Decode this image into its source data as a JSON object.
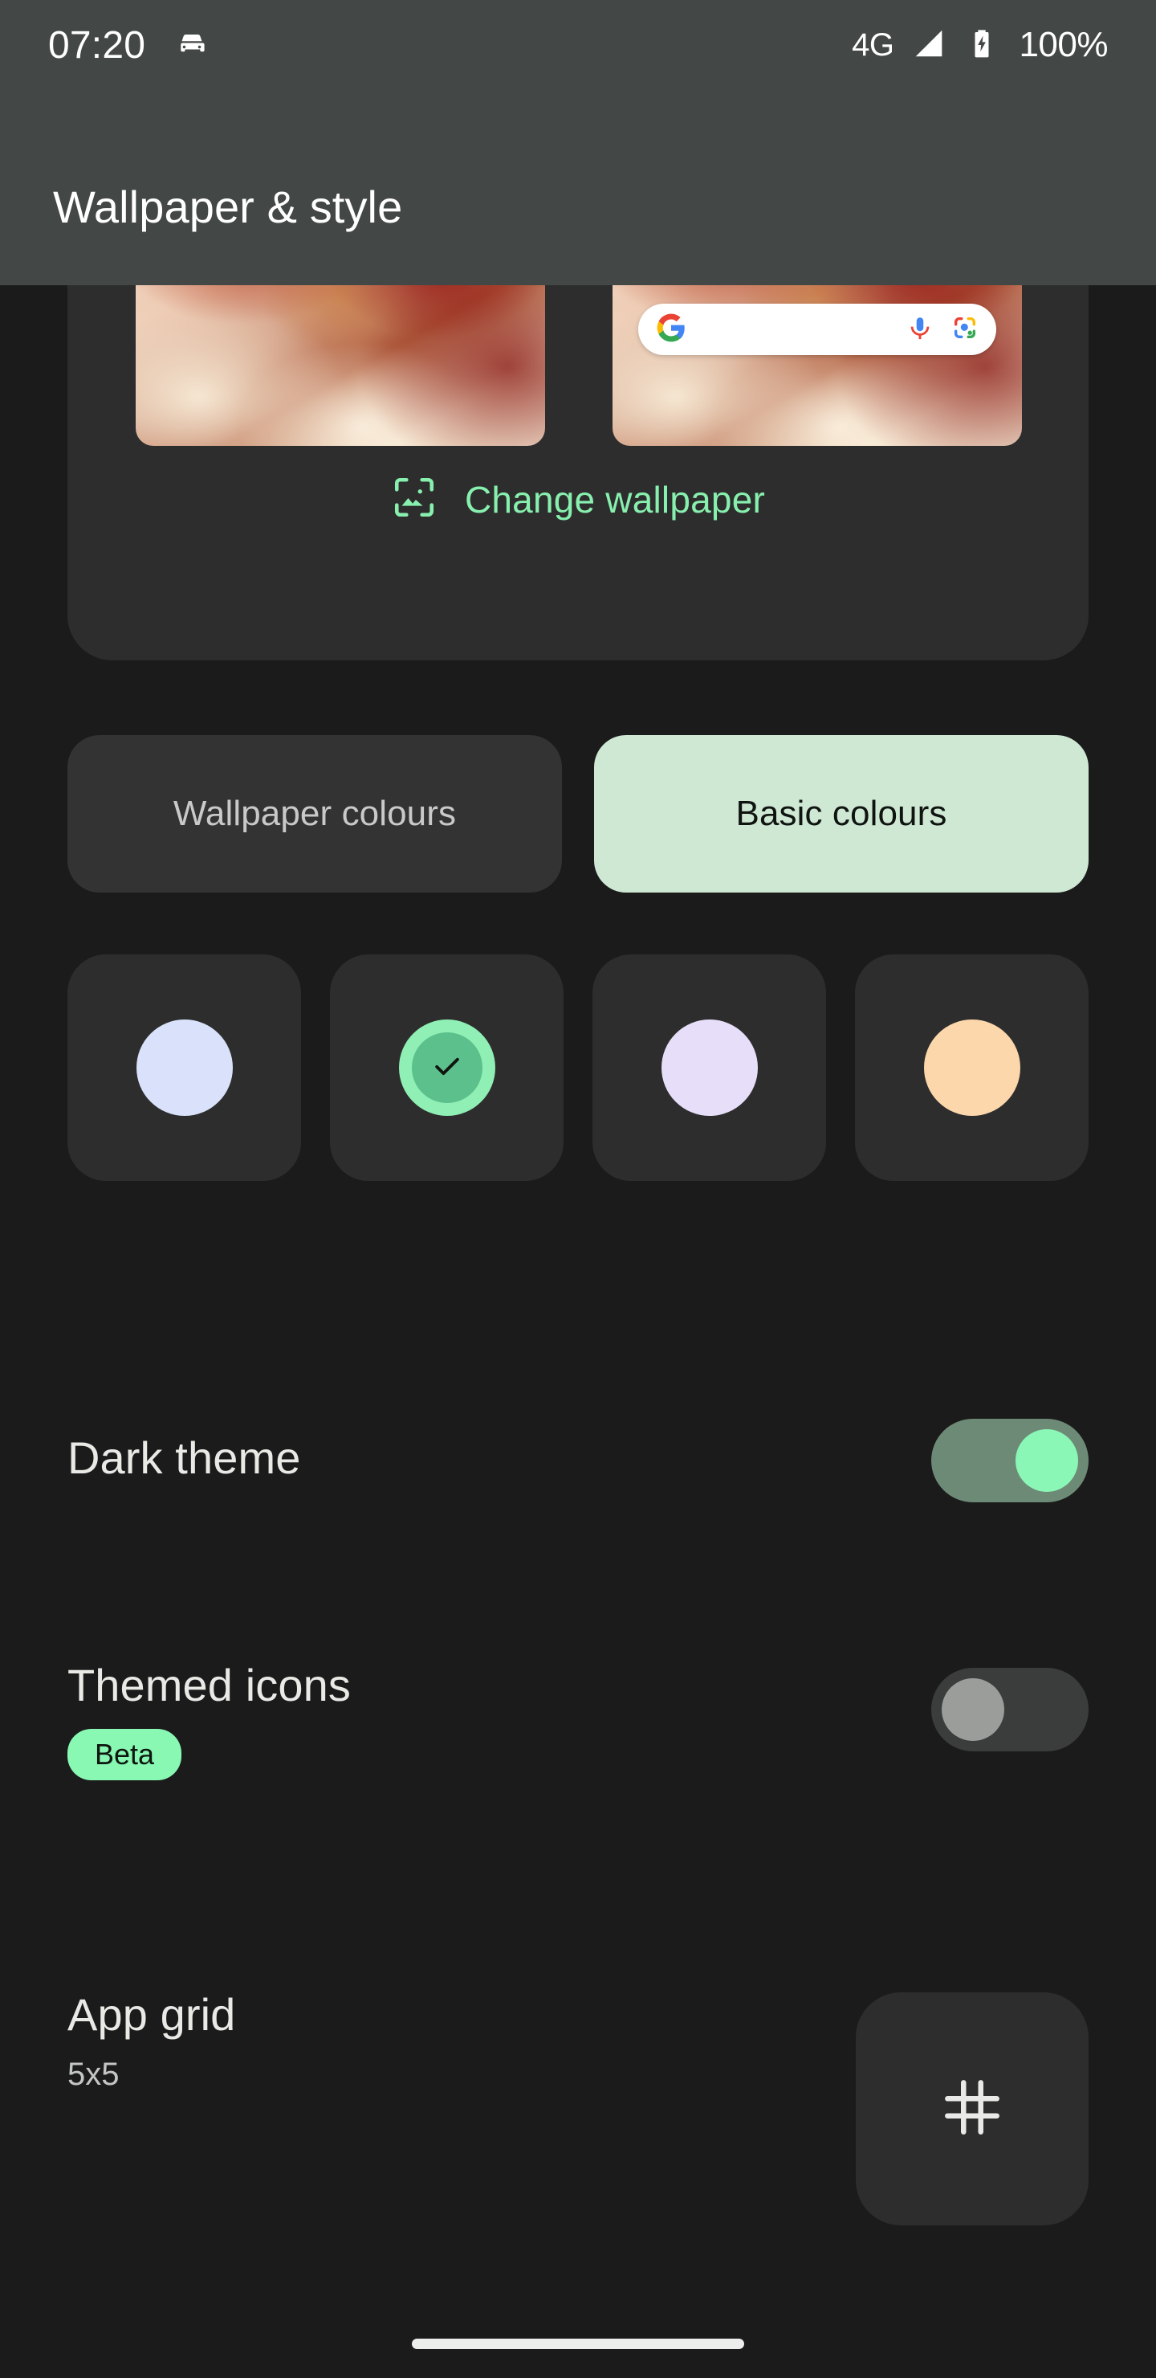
{
  "status_bar": {
    "time": "07:20",
    "driving_mode_icon": "car-icon",
    "network_type": "4G",
    "signal_icon": "signal-bars-icon",
    "battery_icon": "battery-charging-icon",
    "battery_level": "100%"
  },
  "app_bar": {
    "title": "Wallpaper & style",
    "background_color": "#434746"
  },
  "wallpaper_card": {
    "lock_preview_name": "lock-screen-preview",
    "home_preview_name": "home-screen-preview",
    "search_widget": {
      "google_icon": "google-g-icon",
      "mic_icon": "microphone-icon",
      "lens_icon": "google-lens-icon"
    },
    "app_icon_colors": [
      "#1aa05a",
      "#f2b64a",
      "#ffffff",
      "#e8a0a8",
      "#ffffff",
      "#f0c24a",
      "#5b6ef0",
      "#b9b4ef",
      "#ff5722",
      "#f08a3c"
    ],
    "change_wallpaper": {
      "label": "Change wallpaper",
      "icon": "image-frame-icon",
      "color": "#88f0ae"
    }
  },
  "colour_tabs": [
    {
      "label": "Wallpaper colours",
      "selected": false
    },
    {
      "label": "Basic colours",
      "selected": true
    }
  ],
  "colour_swatches": [
    {
      "name": "blue-swatch",
      "color": "#d9e2fa",
      "selected": false
    },
    {
      "name": "green-swatch",
      "color": "#8fefb4",
      "selected": true,
      "inner_color": "#5cc08c",
      "check_icon": "check-icon"
    },
    {
      "name": "purple-swatch",
      "color": "#e7def9",
      "selected": false
    },
    {
      "name": "orange-swatch",
      "color": "#fbd7ab",
      "selected": false
    }
  ],
  "settings": {
    "dark_theme": {
      "title": "Dark theme",
      "toggle_state": "on",
      "track_color": "#6d8a76",
      "knob_color": "#8af7b6"
    },
    "themed_icons": {
      "title": "Themed icons",
      "badge": "Beta",
      "badge_color": "#88f8b3",
      "toggle_state": "off",
      "track_color": "#3a3d3b",
      "knob_color": "#9a9d9a"
    },
    "app_grid": {
      "title": "App grid",
      "value": "5x5",
      "button_icon": "grid-hash-icon"
    }
  },
  "navigation": {
    "home_indicator": "home-gesture-bar"
  },
  "theme": {
    "page_background": "#1b1b1b",
    "surface": "#2d2d2d",
    "accent": "#88f0ae",
    "text_primary": "#e9e9e6",
    "text_secondary": "#c3c7c3"
  }
}
